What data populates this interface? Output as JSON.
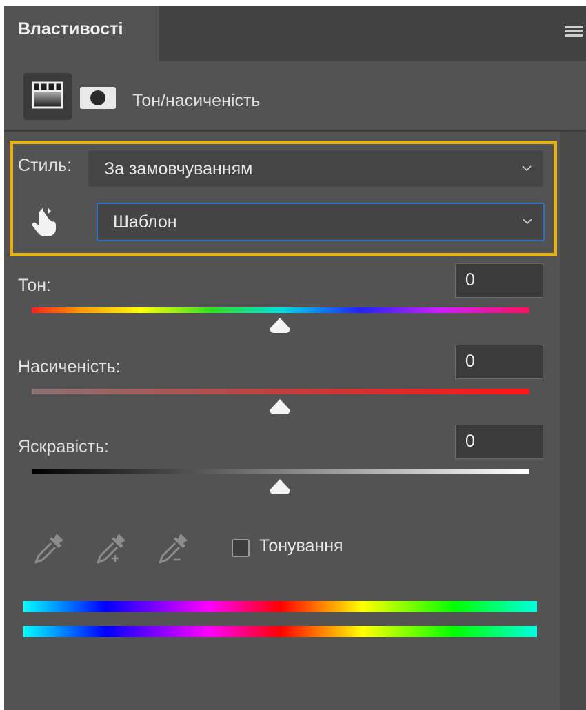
{
  "panel": {
    "tab_label": "Властивості",
    "adjustment_title": "Тон/насиченість"
  },
  "style_row": {
    "label": "Стиль:",
    "value": "За замовчуванням"
  },
  "preset_row": {
    "value": "Шаблон"
  },
  "sliders": {
    "hue": {
      "label": "Тон:",
      "value": "0"
    },
    "saturation": {
      "label": "Насиченість:",
      "value": "0"
    },
    "lightness": {
      "label": "Яскравість:",
      "value": "0"
    }
  },
  "colorize": {
    "label": "Тонування",
    "checked": false
  },
  "colors": {
    "highlight": "#e6b21c",
    "focus_border": "#2f6fc4"
  },
  "icons": [
    "hamburger-menu-icon",
    "adjustment-layer-icon",
    "layer-mask-icon",
    "chevron-down-icon",
    "targeted-adjustment-hand-icon",
    "eyedropper-icon",
    "eyedropper-add-icon",
    "eyedropper-subtract-icon"
  ]
}
